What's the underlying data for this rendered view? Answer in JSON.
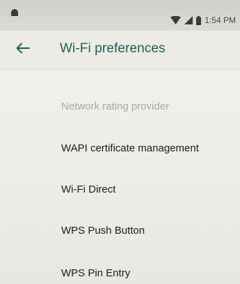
{
  "status_bar": {
    "time": "1:54 PM",
    "icons": [
      "notification-icon",
      "wifi-icon",
      "signal-icon",
      "battery-icon"
    ]
  },
  "app_bar": {
    "back_icon": "arrow-left-icon",
    "title": "Wi-Fi preferences"
  },
  "colors": {
    "accent": "#1d5e59",
    "disabled_text": "#a9a9a5"
  },
  "settings": {
    "items": [
      {
        "label": "Network rating provider",
        "enabled": false
      },
      {
        "label": "WAPI certificate management",
        "enabled": true
      },
      {
        "label": "Wi-Fi Direct",
        "enabled": true
      },
      {
        "label": "WPS Push Button",
        "enabled": true
      },
      {
        "label": "WPS Pin Entry",
        "enabled": true
      }
    ]
  }
}
